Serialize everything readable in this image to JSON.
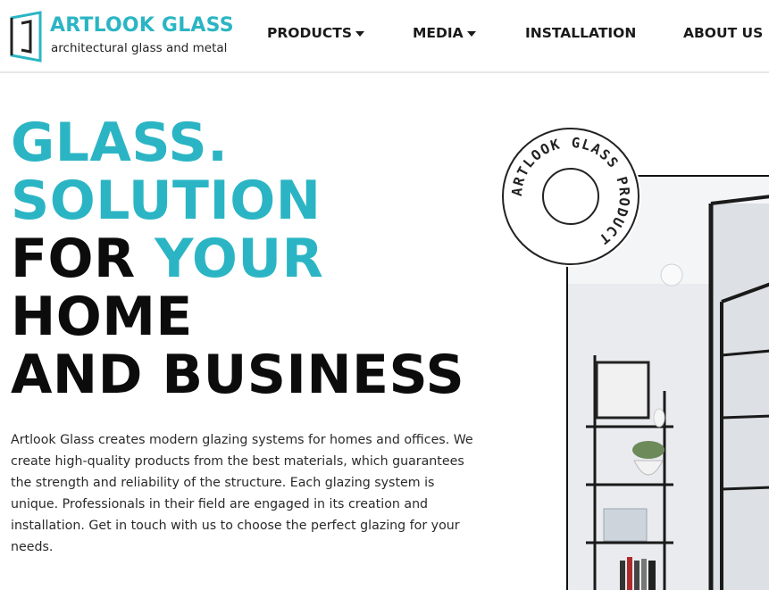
{
  "brand": {
    "name": "ARTLOOK GLASS",
    "tagline": "architectural glass and metal"
  },
  "nav": {
    "products": "PRODUCTS",
    "media": "MEDIA",
    "installation": "INSTALLATION",
    "about": "ABOUT US"
  },
  "hero": {
    "line1": "GLASS.",
    "line2": "SOLUTION",
    "line3_a": "FOR",
    "line3_b": "YOUR",
    "line4": "HOME",
    "line5": "AND BUSINESS",
    "description": "Artlook Glass creates modern glazing systems for homes and offices. We create high-quality products from the best materials, which guarantees the strength and reliability of the structure. Each glazing system is unique. Professionals in their field are engaged in its creation and installation. Get in touch with us to choose the perfect glazing for your needs."
  },
  "badge": {
    "text": "ARTLOOK GLASS PRODUCT"
  },
  "colors": {
    "accent": "#2bb5c4",
    "text": "#0c0c0c",
    "divider": "#e6e6e6"
  },
  "icons": {
    "logo": "glass-frame-logo-icon",
    "dropdown": "caret-down-icon"
  }
}
